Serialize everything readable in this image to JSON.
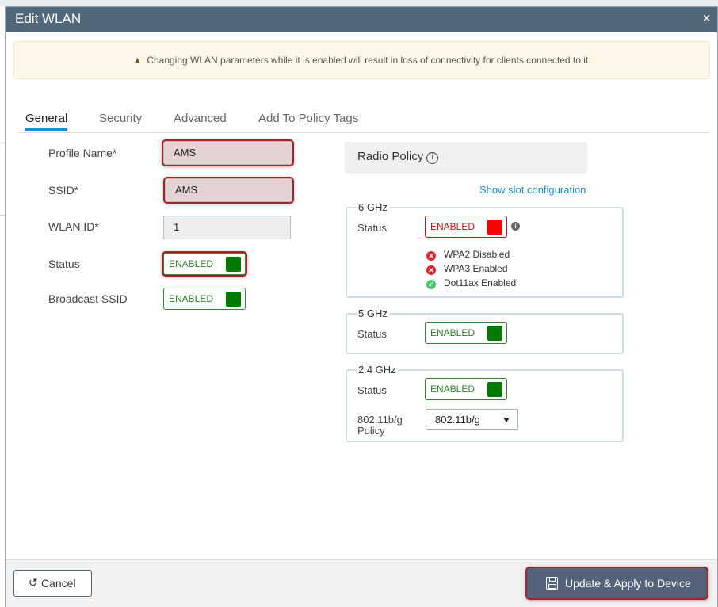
{
  "dialog": {
    "title": "Edit WLAN",
    "close_glyph": "×"
  },
  "warning": {
    "icon": "warning-triangle-icon",
    "text": "Changing WLAN parameters while it is enabled will result in loss of connectivity for clients connected to it."
  },
  "tabs": [
    {
      "label": "General",
      "active": true
    },
    {
      "label": "Security",
      "active": false
    },
    {
      "label": "Advanced",
      "active": false
    },
    {
      "label": "Add To Policy Tags",
      "active": false
    }
  ],
  "general": {
    "profile_name_label": "Profile Name*",
    "profile_name_value": "AMS",
    "ssid_label": "SSID*",
    "ssid_value": "AMS",
    "wlan_id_label": "WLAN ID*",
    "wlan_id_value": "1",
    "status_label": "Status",
    "status_toggle": "ENABLED",
    "broadcast_label": "Broadcast SSID",
    "broadcast_toggle": "ENABLED"
  },
  "radio_policy": {
    "title": "Radio Policy",
    "show_slot_link": "Show slot configuration",
    "band_6": {
      "legend": "6 GHz",
      "status_label": "Status",
      "toggle": "ENABLED",
      "toggle_color": "#ff0000",
      "features": [
        {
          "label": "WPA2 Disabled",
          "ok": false
        },
        {
          "label": "WPA3 Enabled",
          "ok": false
        },
        {
          "label": "Dot11ax Enabled",
          "ok": true
        }
      ]
    },
    "band_5": {
      "legend": "5 GHz",
      "status_label": "Status",
      "toggle": "ENABLED"
    },
    "band_24": {
      "legend": "2.4 GHz",
      "status_label": "Status",
      "toggle": "ENABLED",
      "policy_label_line1": "802.11b/g",
      "policy_label_line2": "Policy",
      "policy_value": "802.11b/g"
    }
  },
  "footer": {
    "cancel_label": "Cancel",
    "update_label": "Update & Apply to Device"
  },
  "colors": {
    "titlebar": "#51677a",
    "accent": "#1b8fc5",
    "enabled_green": "#007a00",
    "highlight_red": "#a4212c"
  }
}
